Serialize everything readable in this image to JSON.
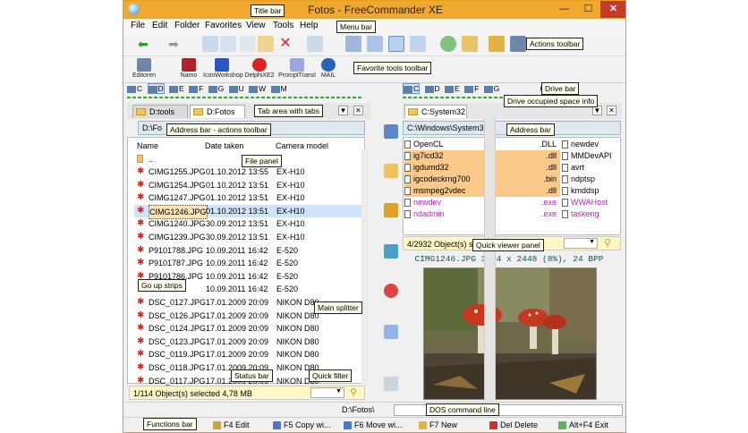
{
  "window": {
    "title": "Fotos - FreeCommander XE",
    "controls": {
      "minimize": "—",
      "maximize": "☐",
      "close": "✕"
    }
  },
  "menu": [
    "File",
    "Edit",
    "Folder",
    "Favorites",
    "View",
    "Tools",
    "Help"
  ],
  "watermark": "FILEHOR.com",
  "favorites": [
    {
      "label": "Editoren",
      "icon": "editor-icon",
      "color": "#6e86a8"
    },
    {
      "label": "Namo",
      "icon": "namo-icon",
      "color": "#b3222a"
    },
    {
      "label": "IconWorkshop",
      "icon": "iconworkshop-icon",
      "color": "#2b55c4"
    },
    {
      "label": "DelphiXE2",
      "icon": "delphi-icon",
      "color": "#d22"
    },
    {
      "label": "PromptTransl",
      "icon": "feather-icon",
      "color": "#6a7bd0"
    },
    {
      "label": "MAIL",
      "icon": "mail-icon",
      "color": "#2963b8"
    }
  ],
  "callouts": {
    "title_bar": "Title bar",
    "menu_bar": "Menu bar",
    "actions_toolbar": "Actions toolbar",
    "favorite_tools_toolbar": "Favorite tools toolbar",
    "drive_bar": "Drive bar",
    "drive_space": "Drive occupied space info",
    "tab_area": "Tab area with tabs",
    "address_bar_actions": "Address bar - actions toolbar",
    "address_bar": "Address bar",
    "file_panel": "File panel",
    "go_up_strips": "Go up strips",
    "main_splitter": "Main splitter",
    "quick_viewer": "Quick viewer panel",
    "status_bar": "Status bar",
    "quick_filter": "Quick filter",
    "dos_command_line": "DOS command line",
    "functions_bar": "Functions bar"
  },
  "left_panel": {
    "drives": [
      "C",
      "D",
      "E",
      "F",
      "G",
      "U",
      "W",
      "M"
    ],
    "tabs": [
      "D:tools",
      "D:Fotos"
    ],
    "address": "D:\\Fo",
    "columns": [
      "Name",
      "Date taken",
      "Camera model"
    ],
    "up_item": "..",
    "files": [
      {
        "name": "CIMG1255.JPG",
        "date": "01.10.2012 13:55",
        "camera": "EX-H10"
      },
      {
        "name": "CIMG1254.JPG",
        "date": "01.10.2012 13:51",
        "camera": "EX-H10"
      },
      {
        "name": "CIMG1247.JPG",
        "date": "01.10.2012 13:51",
        "camera": "EX-H10"
      },
      {
        "name": "CIMG1246.JPG",
        "date": "01.10.2012 13:51",
        "camera": "EX-H10"
      },
      {
        "name": "CIMG1240.JPG",
        "date": "30.09.2012 13:51",
        "camera": "EX-H10"
      },
      {
        "name": "CIMG1239.JPG",
        "date": "30.09.2012 13:51",
        "camera": "EX-H10"
      },
      {
        "name": "P9101788.JPG",
        "date": "10.09.2011 16:42",
        "camera": "E-520"
      },
      {
        "name": "P9101787.JPG",
        "date": "10.09.2011 16:42",
        "camera": "E-520"
      },
      {
        "name": "P9101786.JPG",
        "date": "10.09.2011 16:42",
        "camera": "E-520"
      },
      {
        "name": "",
        "date": "10.09.2011 16:42",
        "camera": "E-520"
      },
      {
        "name": "DSC_0127.JPG",
        "date": "17.01.2009 20:09",
        "camera": "NIKON D80"
      },
      {
        "name": "DSC_0126.JPG",
        "date": "17.01.2009 20:09",
        "camera": "NIKON D80"
      },
      {
        "name": "DSC_0124.JPG",
        "date": "17.01.2009 20:09",
        "camera": "NIKON D80"
      },
      {
        "name": "DSC_0123.JPG",
        "date": "17.01.2009 20:09",
        "camera": "NIKON D80"
      },
      {
        "name": "DSC_0119.JPG",
        "date": "17.01.2009 20:09",
        "camera": "NIKON D80"
      },
      {
        "name": "DSC_0118.JPG",
        "date": "17.01.2009 20:09",
        "camera": "NIKON D80"
      },
      {
        "name": "DSC_0117.JPG",
        "date": "17.01.2009 20:09",
        "camera": "NIKON D80"
      }
    ],
    "status": "1/114 Object(s) selected   4,78 MB"
  },
  "right_panel": {
    "drives": [
      "C",
      "D",
      "E",
      "F",
      "G",
      "0",
      "1"
    ],
    "tab": "C:System32",
    "address": "C:\\Windows\\System32",
    "files_col1": [
      {
        "name": "OpenCL",
        "ext": ".DLL",
        "hl": false
      },
      {
        "name": "ig7icd32",
        "ext": ".dll",
        "hl": true
      },
      {
        "name": "igdumd32",
        "ext": ".dll",
        "hl": true
      },
      {
        "name": "igcodeckrng700",
        "ext": ".bin",
        "hl": true
      },
      {
        "name": "msmpeg2vdec",
        "ext": ".dll",
        "hl": true
      },
      {
        "name": "newdev",
        "ext": ".exe",
        "hl": false
      },
      {
        "name": "ndadmin",
        "ext": ".exe",
        "hl": false
      }
    ],
    "files_col2": [
      "newdev",
      "MMDevAPI",
      "avrt",
      "ndptsp",
      "kmddsp",
      "WWAHost",
      "taskeng"
    ],
    "status": "4/2932 Object(s) se",
    "viewer_header": "CIMG1246.JPG   3264 x 2448 (8%), 24 BPP"
  },
  "dos": {
    "prompt": "D:\\Fotos\\"
  },
  "function_keys": [
    {
      "label": "F4 Edit",
      "color": "#c9a14a"
    },
    {
      "label": "F5 Copy wi...",
      "color": "#4a78c9"
    },
    {
      "label": "F6 Move wi...",
      "color": "#4a78c9"
    },
    {
      "label": "F7 New",
      "color": "#e0b44a"
    },
    {
      "label": "Del Delete",
      "color": "#c33"
    },
    {
      "label": "Alt+F4 Exit",
      "color": "#6a6"
    }
  ]
}
